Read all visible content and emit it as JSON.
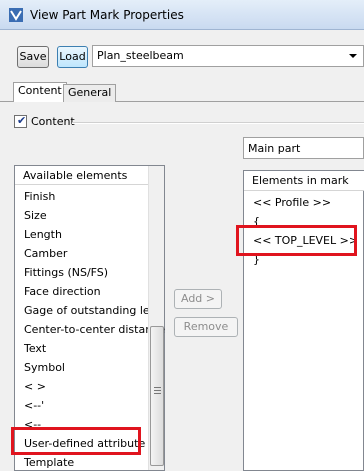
{
  "window": {
    "title": "View Part Mark Properties"
  },
  "toolbar": {
    "save_label": "Save",
    "load_label": "Load",
    "preset_value": "Plan_steelbeam"
  },
  "tabs": [
    {
      "label": "Content"
    },
    {
      "label": "General"
    }
  ],
  "content": {
    "checkbox_label": "Content",
    "checked": true,
    "part_type_value": "Main part"
  },
  "available": {
    "header": "Available elements",
    "items": [
      "Finish",
      "Size",
      "Length",
      "Camber",
      "Fittings (NS/FS)",
      "Face direction",
      "Gage of outstanding leg",
      "Center-to-center distance",
      "Text",
      "Symbol",
      "< >",
      "<--'",
      "<--",
      "User-defined attribute",
      "Template"
    ]
  },
  "buttons": {
    "add_label": "Add >",
    "remove_label": "Remove"
  },
  "mark": {
    "header": "Elements in mark",
    "items": [
      "<< Profile >>",
      "{",
      "<< TOP_LEVEL >>",
      "}"
    ]
  },
  "colors": {
    "highlight": "#e0141e",
    "title_bar": "#c9daf0"
  }
}
